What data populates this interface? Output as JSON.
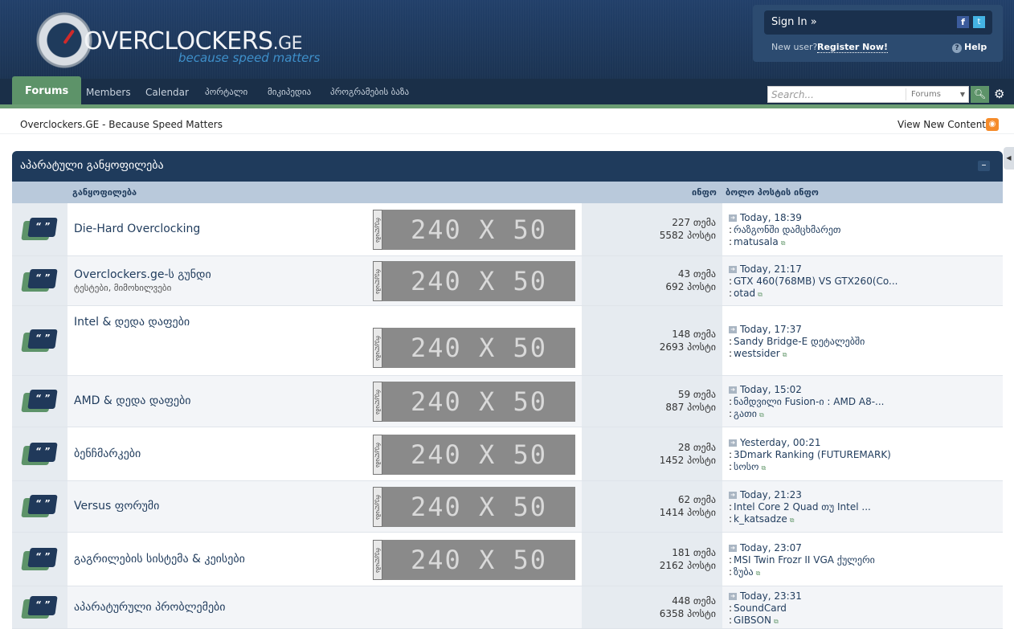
{
  "header": {
    "logo_text": "overclockers",
    "logo_domain": ".ge",
    "logo_tagline": "because speed matters",
    "sign_in": "Sign In »",
    "new_user": "New user?",
    "register": "Register Now!",
    "help": "Help"
  },
  "nav": {
    "tabs": [
      "Forums",
      "Members",
      "Calendar",
      "პორტალი",
      "მიკიპედია",
      "პროგრამების ბაზა"
    ],
    "search_placeholder": "Search...",
    "search_scope": "Forums"
  },
  "breadcrumb": "Overclockers.GE - Because Speed Matters",
  "view_new_content": "View New Content",
  "category": {
    "title": "აპარატული განყოფილება",
    "toggle": "–",
    "col_forum": "განყოფილება",
    "col_stats": "ინფო",
    "col_last": "ბოლო პოსტის ინფო"
  },
  "ad_banner": {
    "side_text": "რეკლამა",
    "text": "240 X 50"
  },
  "forums": [
    {
      "title": "Die-Hard Overclocking",
      "desc": "",
      "topics": "227 თემა",
      "posts": "5582 პოსტი",
      "last_time": "Today, 18:39",
      "last_topic": "რაზგონში დამცხმარეთ",
      "last_user": "matusala",
      "has_ad": true
    },
    {
      "title": "Overclockers.ge-ს გუნდი",
      "desc": "ტესტები, მიმოხილვები",
      "topics": "43 თემა",
      "posts": "692 პოსტი",
      "last_time": "Today, 21:17",
      "last_topic": "GTX 460(768MB) VS GTX260(Co...",
      "last_user": "otad",
      "has_ad": true
    },
    {
      "title": "Intel & დედა დაფები",
      "desc": "",
      "topics": "148 თემა",
      "posts": "2693 პოსტი",
      "last_time": "Today, 17:37",
      "last_topic": "Sandy Bridge-E დეტალებში",
      "last_user": "westsider",
      "has_ad": true
    },
    {
      "title": "AMD & დედა დაფები",
      "desc": "",
      "topics": "59 თემა",
      "posts": "887 პოსტი",
      "last_time": "Today, 15:02",
      "last_topic": "ნამდვილი Fusion-ი : AMD A8-...",
      "last_user": "გათი",
      "has_ad": true
    },
    {
      "title": "ბენჩმარკები",
      "desc": "",
      "topics": "28 თემა",
      "posts": "1452 პოსტი",
      "last_time": "Yesterday, 00:21",
      "last_topic": "3Dmark Ranking (FUTUREMARK)",
      "last_user": "სოსო",
      "has_ad": true
    },
    {
      "title": "Versus ფორუმი",
      "desc": "",
      "topics": "62 თემა",
      "posts": "1414 პოსტი",
      "last_time": "Today, 21:23",
      "last_topic": "Intel Core 2 Quad თუ Intel ...",
      "last_user": "k_katsadze",
      "has_ad": true
    },
    {
      "title": "გაგრილების სისტემა & კეისები",
      "desc": "",
      "topics": "181 თემა",
      "posts": "2162 პოსტი",
      "last_time": "Today, 23:07",
      "last_topic": "MSI Twin Frozr II VGA ქულერი",
      "last_user": "ზუბა",
      "has_ad": true
    },
    {
      "title": "აპარატურული პრობლემები",
      "desc": "",
      "topics": "448 თემა",
      "posts": "6358 პოსტი",
      "last_time": "Today, 23:31",
      "last_topic": "SoundCard",
      "last_user": "GIBSON",
      "has_ad": false
    }
  ]
}
